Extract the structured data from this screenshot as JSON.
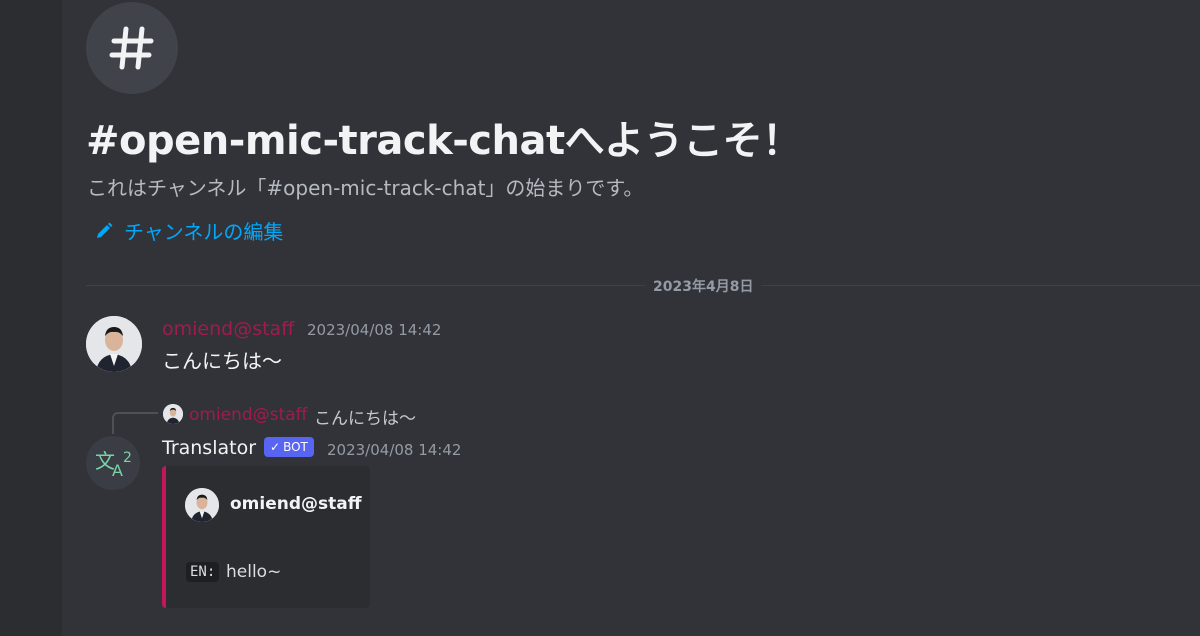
{
  "channel": {
    "hero_icon": "hash-icon",
    "welcome_title": "#open-mic-track-chatへようこそ！",
    "welcome_subtitle": "これはチャンネル「#open-mic-track-chat」の始まりです。",
    "edit_label": "チャンネルの編集",
    "edit_icon": "pencil-icon"
  },
  "date_divider": "2023年4月8日",
  "messages": [
    {
      "author": "omiend@staff",
      "author_color": "#a11b4f",
      "timestamp": "2023/04/08 14:42",
      "text": "こんにちは〜",
      "avatar": "user-avatar"
    },
    {
      "reply": {
        "author": "omiend@staff",
        "text": "こんにちは〜"
      },
      "author": "Translator",
      "author_color": "#f2f3f5",
      "badge": "BOT",
      "timestamp": "2023/04/08 14:42",
      "avatar": "translate-icon",
      "embed": {
        "author": "omiend@staff",
        "lang_code": "EN:",
        "text": "hello~",
        "border_color": "#c2185b"
      }
    }
  ],
  "colors": {
    "background": "#313338",
    "link": "#00a8fc",
    "bot_badge": "#5865f2"
  }
}
